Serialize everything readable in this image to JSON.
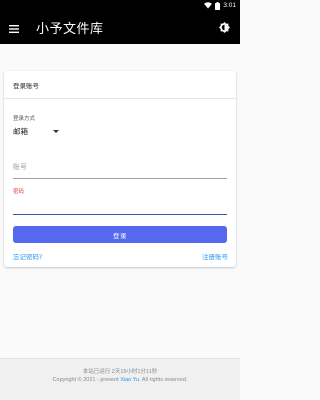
{
  "status_bar": {
    "time": "3:01",
    "icons": [
      "wifi-icon",
      "battery-icon"
    ]
  },
  "app_bar": {
    "title": "小予文件库",
    "icons": [
      "menu-icon",
      "theme-toggle-icon"
    ]
  },
  "login_card": {
    "header": "登录账号",
    "method_label": "登录方式",
    "method_value": "邮箱",
    "account_placeholder": "账号",
    "password_label": "密码",
    "password_value": "",
    "login_button": "登录",
    "forgot_link": "忘记密码?",
    "register_link": "注册账号"
  },
  "footer": {
    "uptime": "本站已运行 2天15小时1分11秒",
    "copyright_prefix": "Copyright © 2021 - present",
    "author": "Xiao Yu",
    "copyright_suffix": ". All rights reserved."
  },
  "colors": {
    "app_bar": "#000000",
    "primary_button": "#5468f0",
    "link": "#2196f3",
    "focus_underline": "#3f51b5",
    "password_label": "#e53935"
  }
}
